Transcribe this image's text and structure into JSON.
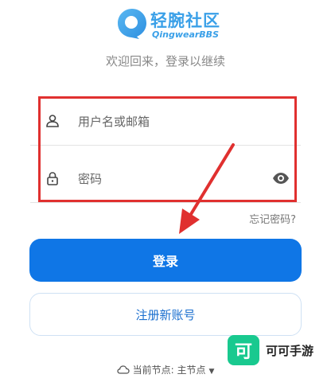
{
  "brand": {
    "title": "轻腕社区",
    "subtitle": "QingwearBBS",
    "color": "#3aa0e8"
  },
  "welcome": "欢迎回来，登录以继续",
  "form": {
    "username_placeholder": "用户名或邮箱",
    "password_placeholder": "密码",
    "forgot_label": "忘记密码?"
  },
  "buttons": {
    "login_label": "登录",
    "register_label": "注册新账号"
  },
  "node": {
    "label": "当前节点: 主节点"
  },
  "watermark": {
    "badge": "可",
    "text": "可可手游"
  },
  "colors": {
    "primary": "#0f76e6",
    "highlight": "#e0302f",
    "watermark": "#19c98f"
  },
  "icons": [
    "user-icon",
    "lock-icon",
    "eye-icon",
    "cloud-icon",
    "caret-down-icon"
  ]
}
